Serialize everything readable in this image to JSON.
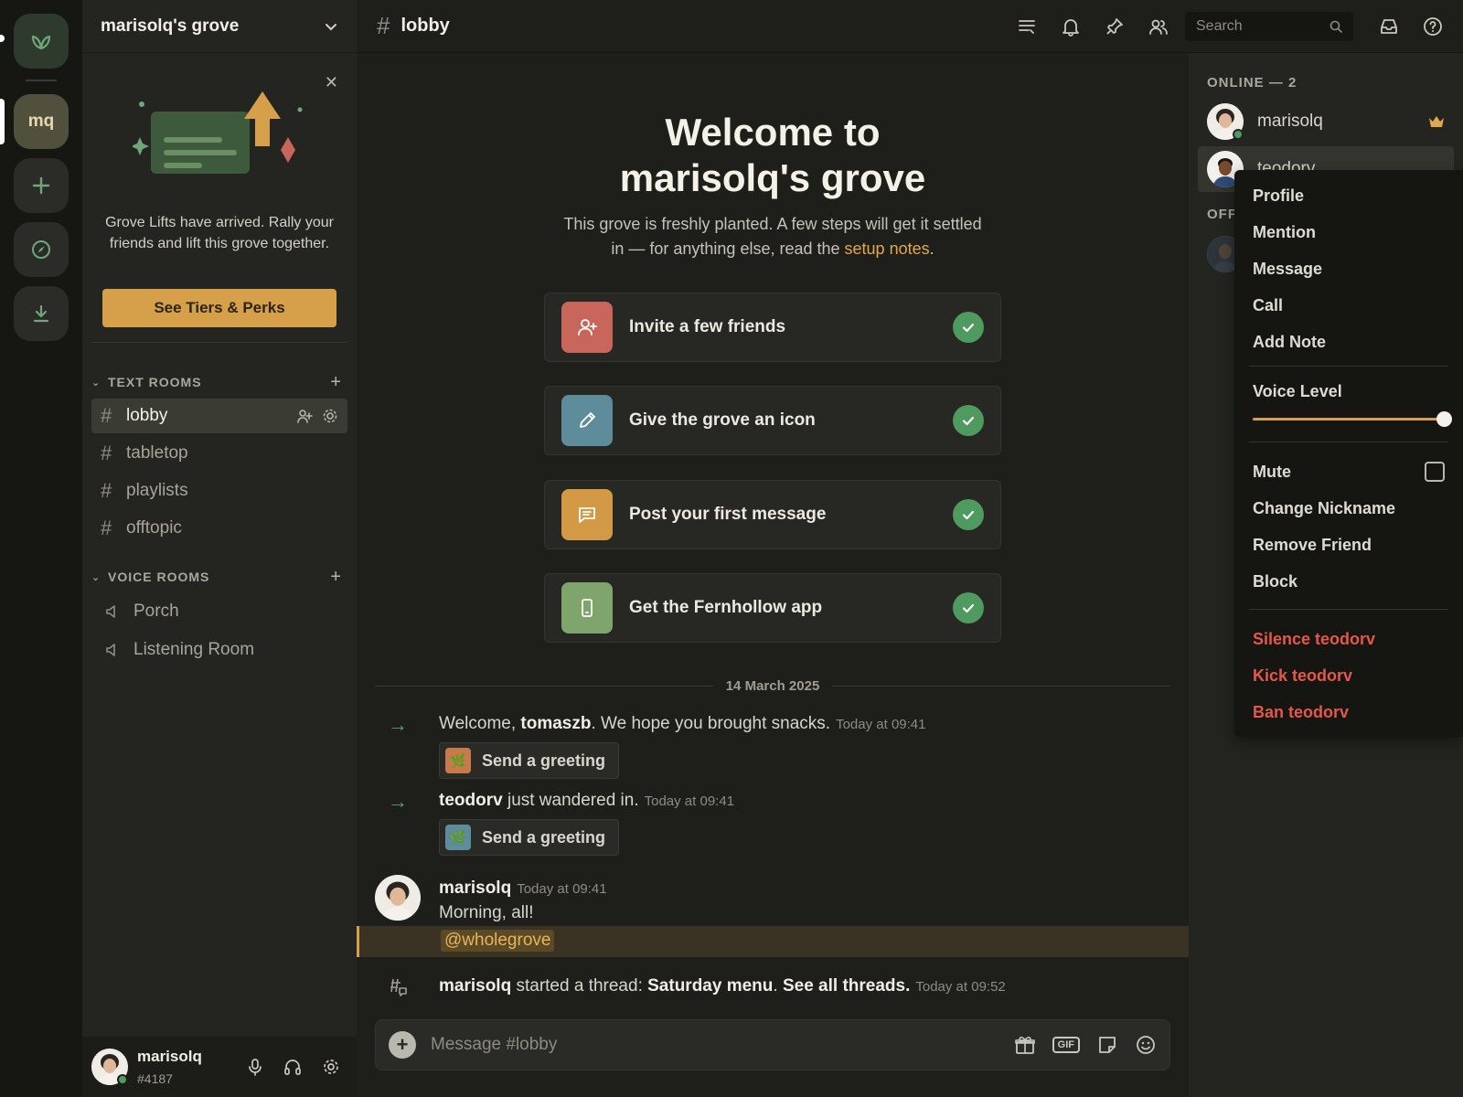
{
  "guild": {
    "name": "marisolq's grove",
    "short": "mq"
  },
  "promo": {
    "text": "Grove Lifts have arrived. Rally your friends and lift this grove together.",
    "button": "See Tiers & Perks"
  },
  "sidebar": {
    "text_category": "TEXT ROOMS",
    "voice_category": "VOICE ROOMS",
    "text_rooms": [
      {
        "name": "lobby",
        "active": true
      },
      {
        "name": "tabletop"
      },
      {
        "name": "playlists"
      },
      {
        "name": "offtopic"
      }
    ],
    "voice_rooms": [
      {
        "name": "Porch"
      },
      {
        "name": "Listening Room"
      }
    ]
  },
  "user": {
    "name": "marisolq",
    "tag": "#4187"
  },
  "topbar": {
    "channel": "lobby",
    "search_placeholder": "Search"
  },
  "welcome": {
    "title_line1": "Welcome to",
    "title_line2": "marisolq's grove",
    "sub_before": "This grove is freshly planted. A few steps will get it settled in — for anything else, read the ",
    "sub_link": "setup notes",
    "sub_after": "."
  },
  "steps": [
    {
      "label": "Invite a few friends",
      "color": "#c8665c",
      "icon": "add-user-icon",
      "done": true
    },
    {
      "label": "Give the grove an icon",
      "color": "#5f8c9a",
      "icon": "pencil-icon",
      "done": true
    },
    {
      "label": "Post your first message",
      "color": "#d29a45",
      "icon": "chat-icon",
      "done": true
    },
    {
      "label": "Get the Fernhollow app",
      "color": "#7fa56c",
      "icon": "phone-icon",
      "done": true
    }
  ],
  "feed": {
    "date": "14 March 2025",
    "join1": {
      "before": "Welcome, ",
      "user": "tomaszb",
      "after": ". We hope you brought snacks.",
      "time": "Today at 09:41"
    },
    "greet_label": "Send a greeting",
    "join2": {
      "user": "teodorv",
      "after": " just wandered in.",
      "time": "Today at 09:41"
    },
    "message": {
      "author": "marisolq",
      "time": "Today at 09:41",
      "text": "Morning, all!",
      "mention": "@wholegrove"
    },
    "thread": {
      "author": "marisolq",
      "mid": " started a thread: ",
      "name": "Saturday menu",
      "sep": ". ",
      "link": "See all threads.",
      "time": "Today at 09:52"
    }
  },
  "composer": {
    "placeholder": "Message #lobby",
    "gif": "GIF"
  },
  "members": {
    "online_header": "ONLINE — 2",
    "offline_header": "OFF",
    "online": [
      {
        "name": "marisolq",
        "owner": true
      },
      {
        "name": "teodorv"
      }
    ]
  },
  "context_menu": {
    "items_top": [
      "Profile",
      "Mention",
      "Message",
      "Call",
      "Add Note"
    ],
    "voice_level_label": "Voice Level",
    "voice_level": 1.0,
    "mute_label": "Mute",
    "items_mid": [
      "Change Nickname",
      "Remove Friend",
      "Block"
    ],
    "items_danger": [
      "Silence teodorv",
      "Kick teodorv",
      "Ban teodorv"
    ]
  },
  "colors": {
    "accent": "#d6a04a",
    "online": "#4f9a5e",
    "danger": "#e5574a"
  }
}
